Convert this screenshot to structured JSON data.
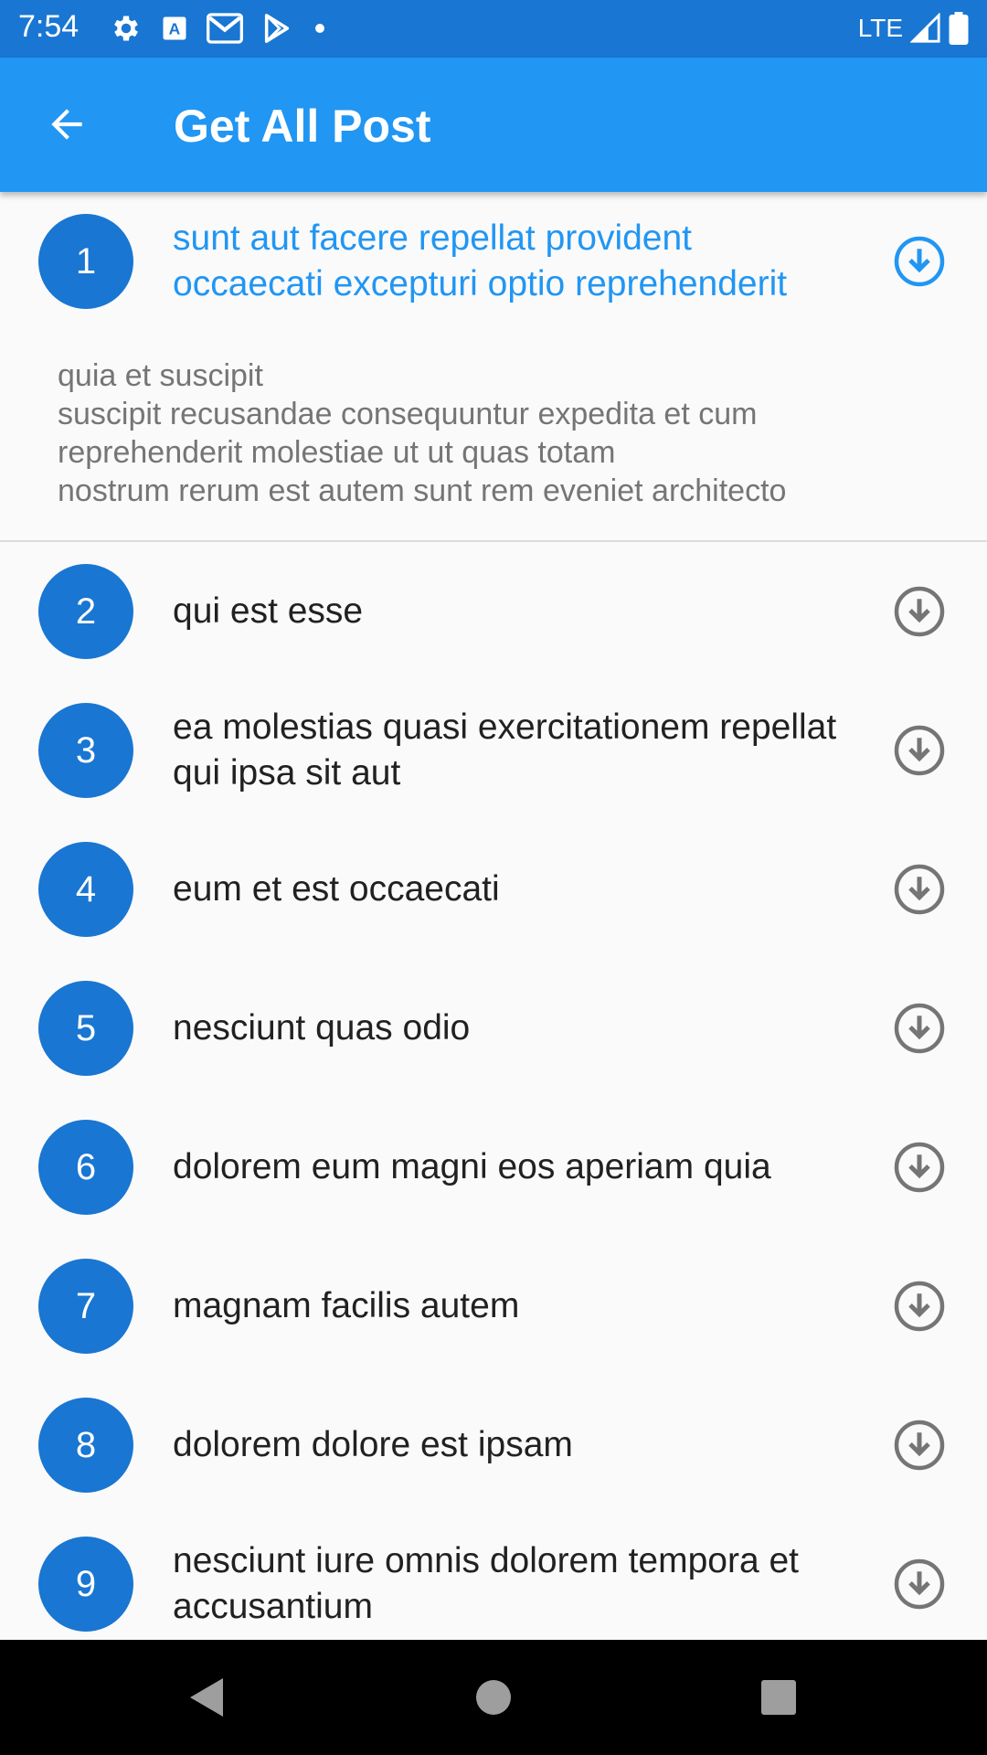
{
  "status_bar": {
    "time": "7:54",
    "network": "LTE",
    "icons": [
      "settings-icon",
      "font-icon",
      "gmail-icon",
      "play-store-icon",
      "dot-icon",
      "signal-icon",
      "battery-icon"
    ]
  },
  "app_bar": {
    "title": "Get All Post",
    "back_icon": "arrow-back-icon",
    "color": "#2196f3"
  },
  "posts": [
    {
      "id": "1",
      "title": "sunt aut facere repellat provident occaecati excepturi optio reprehenderit",
      "body": "quia et suscipit\nsuscipit recusandae consequuntur expedita et cum\nreprehenderit molestiae ut ut quas totam\nnostrum rerum est autem sunt rem eveniet architecto",
      "expanded": true
    },
    {
      "id": "2",
      "title": "qui est esse"
    },
    {
      "id": "3",
      "title": "ea molestias quasi exercitationem repellat qui ipsa sit aut"
    },
    {
      "id": "4",
      "title": "eum et est occaecati"
    },
    {
      "id": "5",
      "title": "nesciunt quas odio"
    },
    {
      "id": "6",
      "title": "dolorem eum magni eos aperiam quia"
    },
    {
      "id": "7",
      "title": "magnam facilis autem"
    },
    {
      "id": "8",
      "title": "dolorem dolore est ipsam"
    },
    {
      "id": "9",
      "title": "nesciunt iure omnis dolorem tempora et accusantium"
    }
  ],
  "colors": {
    "avatar": "#1976d2",
    "expanded_title": "#2196f3",
    "download_icon_collapsed": "#757575",
    "download_icon_expanded": "#2196f3"
  },
  "nav_bar": {
    "icons": [
      "back-triangle-icon",
      "home-circle-icon",
      "recents-square-icon"
    ]
  }
}
